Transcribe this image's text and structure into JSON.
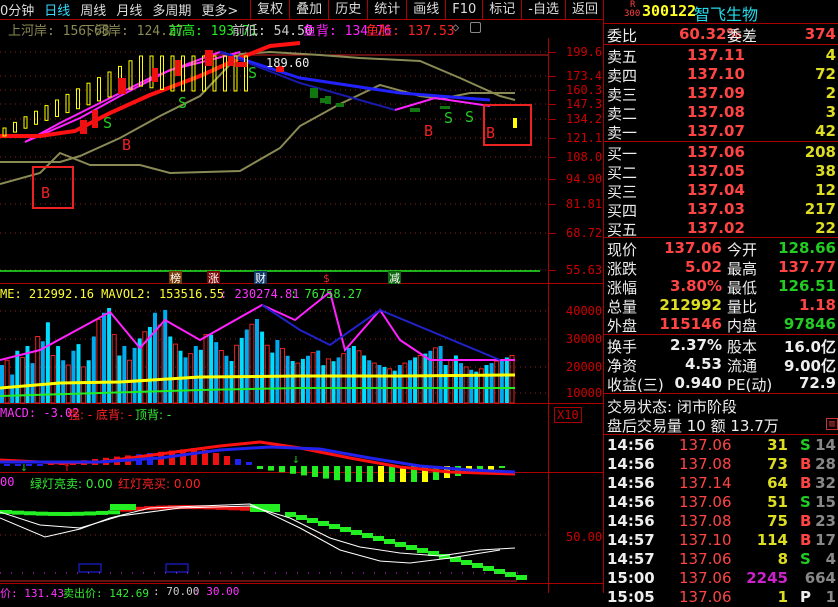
{
  "toolbar": {
    "left": [
      "0分钟",
      "日线",
      "周线",
      "月线",
      "多周期",
      "更多>"
    ],
    "active": "日线",
    "right": [
      "复权",
      "叠加",
      "历史",
      "统计",
      "画线",
      "F10",
      "标记",
      "-自选",
      "返回"
    ]
  },
  "info": {
    "upper_bank": "上河岸: 156.68",
    "lower_bank": "下河岸: 124.27",
    "prev_high": "前高: 193.71",
    "prev_low": "前低: 54.50",
    "fish_back": "鱼背: 134.76",
    "fish_belly": "鱼肚: 137.53"
  },
  "main_chart": {
    "price_axis": [
      "199.6",
      "173.4",
      "160.3",
      "147.3",
      "134.2",
      "121.1",
      "108.0",
      "94.90",
      "81.81",
      "68.72",
      "55.63"
    ],
    "high_label": "189.60",
    "signals": [
      "B",
      "S",
      "S",
      "B",
      "S",
      "S",
      "B",
      "S",
      "B"
    ],
    "event_tags": [
      "榜",
      "涨",
      "财",
      "$",
      "减"
    ]
  },
  "volume": {
    "legend": "ME: 212992.16  MAVOL2: 153516.55",
    "v3": ": 230274.81",
    "v4": ": 76758.27",
    "axis": [
      "40000",
      "30000",
      "20000",
      "10000"
    ],
    "unit": "X10"
  },
  "macd": {
    "legend": "MACD: -3.02",
    "strong": "强: -",
    "bottom_div": "底背: -",
    "top_div": "顶背: -"
  },
  "lights": {
    "prefix": "00",
    "green": "绿灯亮卖: 0.00",
    "red": "红灯亮买: 0.00",
    "axis": "50.00"
  },
  "bottom_legend": {
    "buy": "价: 131.43",
    "sell": "卖出价: 142.69",
    "v1": ": 70.00",
    "v2": ": 30.00"
  },
  "stock": {
    "badge_top": "R",
    "badge_bottom": "300",
    "code": "300122",
    "name": "智飞生物"
  },
  "order_ratio": {
    "label": "委比",
    "value": "60.32%",
    "diff_label": "委差",
    "diff": "374"
  },
  "asks": [
    {
      "label": "卖五",
      "price": "137.11",
      "vol": "4"
    },
    {
      "label": "卖四",
      "price": "137.10",
      "vol": "72"
    },
    {
      "label": "卖三",
      "price": "137.09",
      "vol": "2"
    },
    {
      "label": "卖二",
      "price": "137.08",
      "vol": "3"
    },
    {
      "label": "卖一",
      "price": "137.07",
      "vol": "42"
    }
  ],
  "bids": [
    {
      "label": "买一",
      "price": "137.06",
      "vol": "208"
    },
    {
      "label": "买二",
      "price": "137.05",
      "vol": "38"
    },
    {
      "label": "买三",
      "price": "137.04",
      "vol": "12"
    },
    {
      "label": "买四",
      "price": "137.03",
      "vol": "217"
    },
    {
      "label": "买五",
      "price": "137.02",
      "vol": "22"
    }
  ],
  "quote": [
    {
      "l1": "现价",
      "v1": "137.06",
      "c1": "red",
      "l2": "今开",
      "v2": "128.66",
      "c2": "grn"
    },
    {
      "l1": "涨跌",
      "v1": "5.02",
      "c1": "red",
      "l2": "最高",
      "v2": "137.77",
      "c2": "red"
    },
    {
      "l1": "涨幅",
      "v1": "3.80%",
      "c1": "red",
      "l2": "最低",
      "v2": "126.51",
      "c2": "grn"
    },
    {
      "l1": "总量",
      "v1": "212992",
      "c1": "yel",
      "l2": "量比",
      "v2": "1.18",
      "c2": "red"
    },
    {
      "l1": "外盘",
      "v1": "115146",
      "c1": "red",
      "l2": "内盘",
      "v2": "97846",
      "c2": "grn"
    }
  ],
  "fund": [
    {
      "l1": "换手",
      "v1": "2.37%",
      "l2": "股本",
      "v2": "16.0亿"
    },
    {
      "l1": "净资",
      "v1": "4.53",
      "l2": "流通",
      "v2": "9.00亿"
    },
    {
      "l1": "收益(三)",
      "v1": "0.940",
      "l2": "PE(动)",
      "v2": "72.9"
    }
  ],
  "status": {
    "trade_state": "交易状态: 闭市阶段",
    "after_hours": "盘后交易量 10 额 13.7万"
  },
  "ticks": [
    {
      "t": "14:56",
      "p": "137.06",
      "v": "31",
      "s": "S",
      "n": "14"
    },
    {
      "t": "14:56",
      "p": "137.08",
      "v": "73",
      "s": "B",
      "n": "28"
    },
    {
      "t": "14:56",
      "p": "137.14",
      "v": "64",
      "s": "B",
      "n": "32"
    },
    {
      "t": "14:56",
      "p": "137.06",
      "v": "51",
      "s": "S",
      "n": "15"
    },
    {
      "t": "14:56",
      "p": "137.08",
      "v": "75",
      "s": "B",
      "n": "23"
    },
    {
      "t": "14:57",
      "p": "137.10",
      "v": "114",
      "s": "B",
      "n": "17"
    },
    {
      "t": "14:57",
      "p": "137.06",
      "v": "8",
      "s": "S",
      "n": "4"
    },
    {
      "t": "15:00",
      "p": "137.06",
      "v": "2245",
      "s": "",
      "n": "664"
    },
    {
      "t": "15:05",
      "p": "137.06",
      "v": "1",
      "s": "P",
      "n": "1"
    }
  ]
}
